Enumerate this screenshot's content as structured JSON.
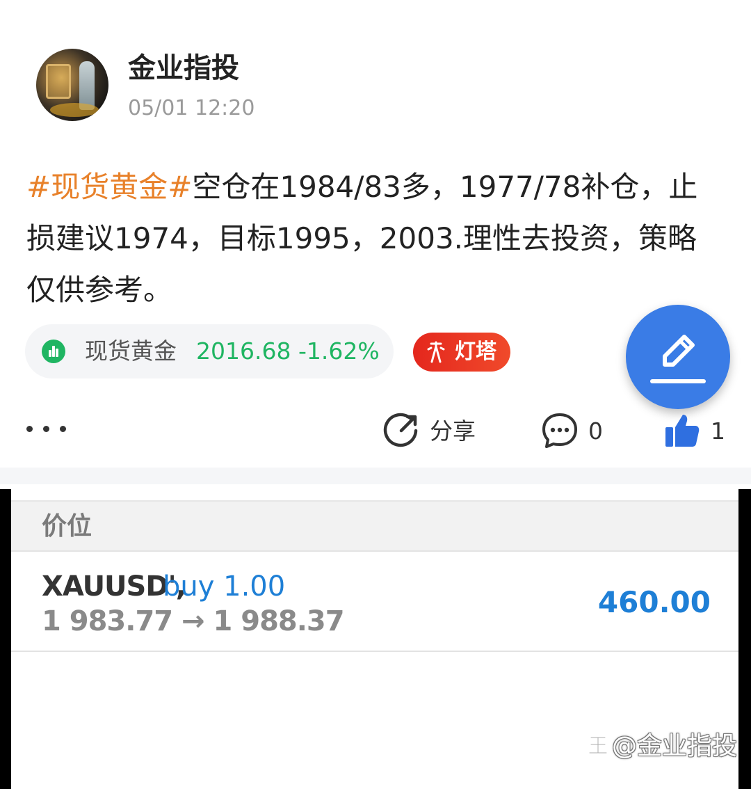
{
  "post": {
    "author": "金业指投",
    "time": "05/01 12:20",
    "hashtag": "#现货黄金#",
    "body": "空仓在1984/83多，1977/78补仓，止损建议1974，目标1995，2003.理性去投资，策略仅供参考。",
    "stock_chip": {
      "icon": "bar-chart-icon",
      "name": "现货黄金",
      "price_change": "2016.68 -1.62%",
      "color": "#1fb562"
    },
    "tag_badge": {
      "icon": "lighthouse-icon",
      "label": "灯塔",
      "color": "#e4271d"
    },
    "fab": {
      "icon": "edit-pen-icon",
      "color": "#3a7ce6"
    },
    "actions": {
      "more_icon": "more-dots-icon",
      "share": {
        "icon": "share-icon",
        "label": "分享"
      },
      "comment": {
        "icon": "comment-icon",
        "count": "0"
      },
      "like": {
        "icon": "thumbs-up-icon",
        "count": "1",
        "color": "#2f6fe0"
      }
    }
  },
  "trade_screenshot": {
    "header": "价位",
    "symbol": "XAUUSD',",
    "side": "buy 1.00",
    "prices": "1 983.77 → 1 988.37",
    "profit": "460.00",
    "accent": "#1e7fd6"
  },
  "watermark": {
    "icon": "zhihu-logo-icon",
    "text": "@金业指投"
  }
}
